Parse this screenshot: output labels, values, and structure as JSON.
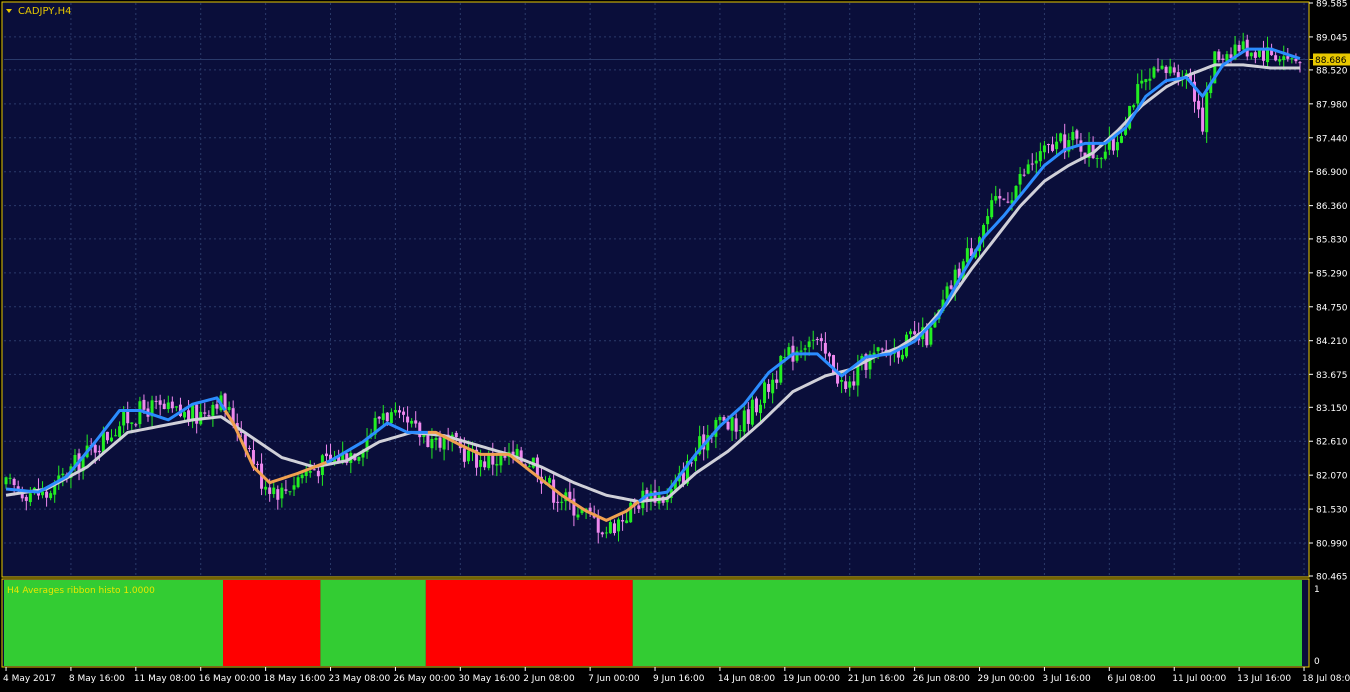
{
  "window": {
    "symbol_title": "CADJPY,H4",
    "current_price": "88.686"
  },
  "colors": {
    "background": "#0a0e3a",
    "grid": "#2a3a6a",
    "frame": "#e8c800",
    "bull_candle": "#22ee22",
    "bear_candle": "#ee88ee",
    "fast_ma_up": "#2b8cff",
    "fast_ma_down": "#f0a050",
    "slow_ma": "#d0d0d8",
    "axis_text": "#ffffff",
    "indicator_title": "#e8e800",
    "histo_up": "#33cc33",
    "histo_down": "#ff0000",
    "price_tag_bg": "#e8c800"
  },
  "indicator": {
    "title": "H4 Averages ribbon histo 1.0000",
    "scale_top": "1",
    "scale_bottom": "0"
  },
  "chart_data": [
    {
      "type": "candlestick",
      "title": "CADJPY,H4",
      "ylim": [
        80.465,
        89.585
      ],
      "y_ticks": [
        "89.585",
        "89.045",
        "88.520",
        "87.980",
        "87.440",
        "86.900",
        "86.360",
        "85.830",
        "85.290",
        "84.750",
        "84.210",
        "83.675",
        "83.150",
        "82.610",
        "82.070",
        "81.530",
        "80.990",
        "80.465"
      ],
      "x_ticks": [
        "4 May 2017",
        "8 May 16:00",
        "11 May 08:00",
        "16 May 00:00",
        "18 May 16:00",
        "23 May 08:00",
        "26 May 00:00",
        "30 May 16:00",
        "2 Jun 08:00",
        "7 Jun 00:00",
        "9 Jun 16:00",
        "14 Jun 08:00",
        "19 Jun 00:00",
        "21 Jun 16:00",
        "26 Jun 08:00",
        "29 Jun 00:00",
        "3 Jul 16:00",
        "6 Jul 08:00",
        "11 Jul 00:00",
        "13 Jul 16:00",
        "18 Jul 08:00"
      ],
      "grid": true,
      "price_anchors": [
        [
          0,
          81.9
        ],
        [
          10,
          81.75
        ],
        [
          18,
          82.3
        ],
        [
          28,
          82.9
        ],
        [
          35,
          83.15
        ],
        [
          42,
          83.05
        ],
        [
          47,
          83.0
        ],
        [
          52,
          83.3
        ],
        [
          58,
          82.8
        ],
        [
          63,
          82.0
        ],
        [
          68,
          81.8
        ],
        [
          73,
          82.1
        ],
        [
          80,
          82.3
        ],
        [
          87,
          82.5
        ],
        [
          93,
          83.1
        ],
        [
          97,
          82.9
        ],
        [
          103,
          82.7
        ],
        [
          110,
          82.55
        ],
        [
          117,
          82.3
        ],
        [
          124,
          82.35
        ],
        [
          130,
          82.3
        ],
        [
          135,
          81.8
        ],
        [
          142,
          81.5
        ],
        [
          148,
          81.2
        ],
        [
          152,
          81.4
        ],
        [
          158,
          81.8
        ],
        [
          163,
          81.7
        ],
        [
          168,
          82.2
        ],
        [
          175,
          82.95
        ],
        [
          180,
          82.8
        ],
        [
          187,
          83.4
        ],
        [
          192,
          83.9
        ],
        [
          198,
          84.3
        ],
        [
          204,
          83.8
        ],
        [
          207,
          83.4
        ],
        [
          212,
          83.9
        ],
        [
          218,
          84.05
        ],
        [
          223,
          84.2
        ],
        [
          228,
          84.3
        ],
        [
          233,
          85.1
        ],
        [
          238,
          85.7
        ],
        [
          243,
          86.3
        ],
        [
          248,
          86.6
        ],
        [
          253,
          87.05
        ],
        [
          258,
          87.3
        ],
        [
          263,
          87.4
        ],
        [
          268,
          87.2
        ],
        [
          273,
          87.3
        ],
        [
          278,
          88.1
        ],
        [
          283,
          88.4
        ],
        [
          288,
          88.55
        ],
        [
          292,
          88.4
        ],
        [
          295,
          87.7
        ],
        [
          298,
          88.7
        ],
        [
          303,
          88.9
        ],
        [
          308,
          88.85
        ],
        [
          314,
          88.75
        ],
        [
          319,
          88.65
        ]
      ],
      "fast_ma_anchors": [
        [
          0,
          81.85
        ],
        [
          8,
          81.8
        ],
        [
          15,
          82.05
        ],
        [
          22,
          82.6
        ],
        [
          28,
          83.1
        ],
        [
          33,
          83.1
        ],
        [
          40,
          82.95
        ],
        [
          46,
          83.2
        ],
        [
          52,
          83.3
        ],
        [
          56,
          82.9
        ],
        [
          61,
          82.2
        ],
        [
          65,
          81.95
        ],
        [
          72,
          82.1
        ],
        [
          80,
          82.3
        ],
        [
          88,
          82.6
        ],
        [
          94,
          82.9
        ],
        [
          99,
          82.75
        ],
        [
          106,
          82.75
        ],
        [
          112,
          82.55
        ],
        [
          117,
          82.4
        ],
        [
          124,
          82.4
        ],
        [
          130,
          82.1
        ],
        [
          137,
          81.75
        ],
        [
          143,
          81.5
        ],
        [
          148,
          81.35
        ],
        [
          153,
          81.5
        ],
        [
          158,
          81.75
        ],
        [
          163,
          81.8
        ],
        [
          170,
          82.4
        ],
        [
          176,
          82.85
        ],
        [
          182,
          83.2
        ],
        [
          188,
          83.7
        ],
        [
          194,
          84.0
        ],
        [
          200,
          84.0
        ],
        [
          206,
          83.65
        ],
        [
          212,
          83.95
        ],
        [
          218,
          84.0
        ],
        [
          224,
          84.2
        ],
        [
          230,
          84.6
        ],
        [
          236,
          85.3
        ],
        [
          241,
          85.85
        ],
        [
          246,
          86.2
        ],
        [
          251,
          86.6
        ],
        [
          256,
          87.0
        ],
        [
          261,
          87.25
        ],
        [
          266,
          87.35
        ],
        [
          271,
          87.35
        ],
        [
          276,
          87.6
        ],
        [
          281,
          88.1
        ],
        [
          286,
          88.35
        ],
        [
          291,
          88.4
        ],
        [
          295,
          88.1
        ],
        [
          300,
          88.6
        ],
        [
          306,
          88.85
        ],
        [
          312,
          88.85
        ],
        [
          319,
          88.7
        ]
      ],
      "fast_ma_down_ranges": [
        [
          54,
          78
        ],
        [
          104,
          155
        ]
      ],
      "slow_ma_anchors": [
        [
          0,
          81.75
        ],
        [
          10,
          81.85
        ],
        [
          20,
          82.2
        ],
        [
          30,
          82.75
        ],
        [
          38,
          82.85
        ],
        [
          46,
          82.95
        ],
        [
          53,
          83.0
        ],
        [
          60,
          82.7
        ],
        [
          68,
          82.35
        ],
        [
          76,
          82.2
        ],
        [
          84,
          82.3
        ],
        [
          92,
          82.6
        ],
        [
          100,
          82.75
        ],
        [
          108,
          82.7
        ],
        [
          116,
          82.55
        ],
        [
          124,
          82.4
        ],
        [
          132,
          82.2
        ],
        [
          140,
          81.95
        ],
        [
          148,
          81.75
        ],
        [
          156,
          81.65
        ],
        [
          163,
          81.7
        ],
        [
          170,
          82.1
        ],
        [
          178,
          82.45
        ],
        [
          186,
          82.9
        ],
        [
          194,
          83.4
        ],
        [
          202,
          83.65
        ],
        [
          208,
          83.75
        ],
        [
          214,
          83.95
        ],
        [
          220,
          84.1
        ],
        [
          226,
          84.35
        ],
        [
          232,
          84.8
        ],
        [
          238,
          85.35
        ],
        [
          244,
          85.85
        ],
        [
          250,
          86.35
        ],
        [
          256,
          86.75
        ],
        [
          262,
          87.0
        ],
        [
          268,
          87.2
        ],
        [
          274,
          87.55
        ],
        [
          280,
          87.95
        ],
        [
          286,
          88.25
        ],
        [
          292,
          88.45
        ],
        [
          298,
          88.6
        ],
        [
          305,
          88.6
        ],
        [
          312,
          88.55
        ],
        [
          319,
          88.55
        ]
      ]
    },
    {
      "type": "histogram",
      "title": "H4 Averages ribbon histo 1.0000",
      "ylim": [
        0,
        1
      ],
      "segments": [
        {
          "state": "up",
          "from": "4 May 2017",
          "to": "16 May 00:00"
        },
        {
          "state": "down",
          "from": "16 May 00:00",
          "to": "22 May 20:00"
        },
        {
          "state": "up",
          "from": "22 May 20:00",
          "to": "29 May 20:00"
        },
        {
          "state": "down",
          "from": "29 May 20:00",
          "to": "9 Jun 12:00"
        },
        {
          "state": "up",
          "from": "9 Jun 12:00",
          "to": "18 Jul 08:00"
        }
      ],
      "segment_bar_ranges": [
        [
          0,
          54
        ],
        [
          54,
          78
        ],
        [
          78,
          104
        ],
        [
          104,
          155
        ],
        [
          155,
          320
        ]
      ]
    }
  ]
}
